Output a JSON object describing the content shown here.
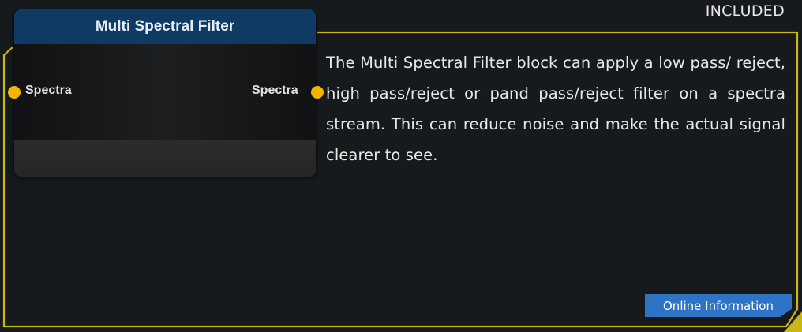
{
  "badge": "INCLUDED",
  "node": {
    "title": "Multi Spectral Filter",
    "input_port_label": "Spectra",
    "output_port_label": "Spectra"
  },
  "description": "The Multi Spectral Filter block can apply a low pass/ reject, high pass/reject or pand pass/reject filter on a spectra stream. This can reduce noise and make the actual signal clearer to see.",
  "info_button_label": "Online Information",
  "colors": {
    "border_accent": "#c9b716",
    "node_header": "#0e3a63",
    "port": "#f5b400",
    "button": "#2f73c5",
    "background": "#161a1c"
  },
  "icons": {
    "port_in": "port-dot-icon",
    "port_out": "port-dot-icon"
  }
}
